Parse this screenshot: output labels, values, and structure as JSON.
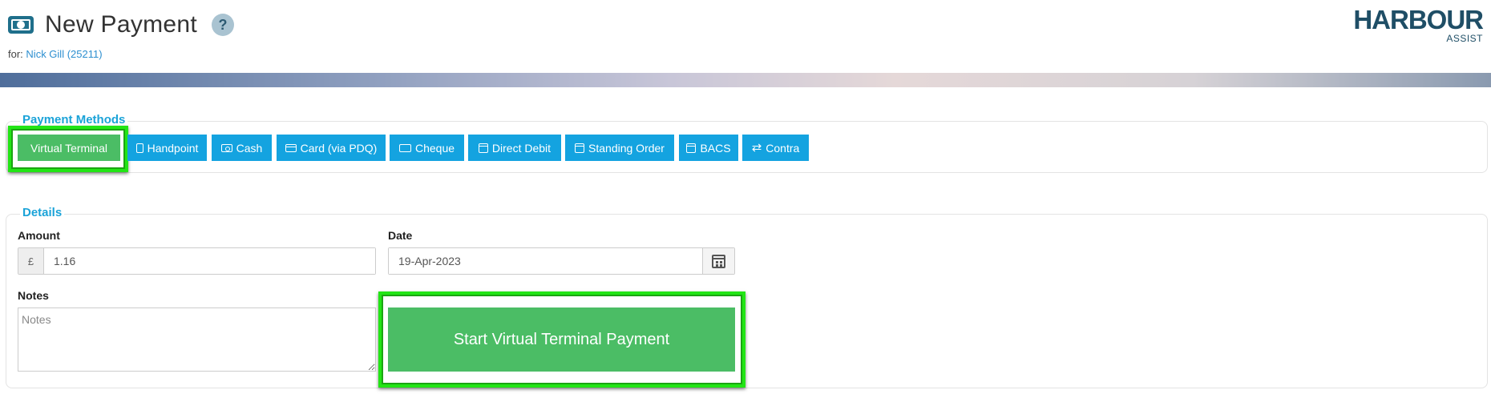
{
  "header": {
    "title": "New Payment",
    "help_icon": "?",
    "for_label": "for:",
    "client_link": "Nick Gill (25211)",
    "logo_main": "HARBOUR",
    "logo_sub": "ASSIST"
  },
  "payment_methods": {
    "legend": "Payment Methods",
    "buttons": [
      {
        "label": "Virtual Terminal",
        "icon": "none",
        "active": true
      },
      {
        "label": "Handpoint",
        "icon": "calculator-icon"
      },
      {
        "label": "Cash",
        "icon": "cash-icon"
      },
      {
        "label": "Card (via PDQ)",
        "icon": "card-icon"
      },
      {
        "label": "Cheque",
        "icon": "cheque-icon"
      },
      {
        "label": "Direct Debit",
        "icon": "calendar-icon"
      },
      {
        "label": "Standing Order",
        "icon": "calendar-icon"
      },
      {
        "label": "BACS",
        "icon": "calendar-icon"
      },
      {
        "label": "Contra",
        "icon": "exchange-icon"
      }
    ]
  },
  "details": {
    "legend": "Details",
    "amount_label": "Amount",
    "currency_symbol": "£",
    "amount_value": "1.16",
    "date_label": "Date",
    "date_value": "19-Apr-2023",
    "notes_label": "Notes",
    "notes_placeholder": "Notes",
    "start_button": "Start Virtual Terminal Payment"
  },
  "colors": {
    "primary_button": "#14a3e0",
    "active_button": "#4bbd65",
    "legend": "#1ba3d8",
    "highlight": "#22e515",
    "logo": "#1f4e66"
  }
}
